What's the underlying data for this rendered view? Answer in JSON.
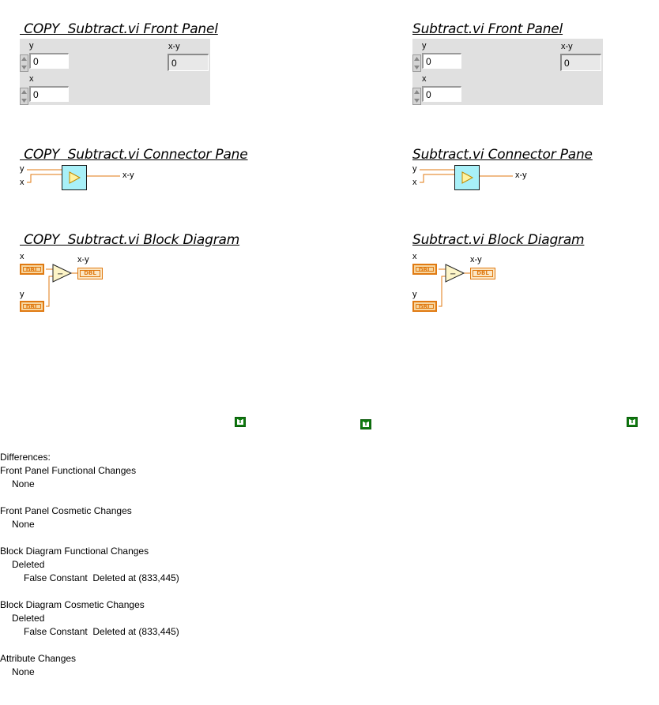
{
  "left": {
    "titles": {
      "front_panel": " COPY  Subtract.vi Front Panel",
      "connector_pane": " COPY  Subtract.vi Connector Pane",
      "block_diagram": " COPY  Subtract.vi Block Diagram"
    }
  },
  "right": {
    "titles": {
      "front_panel": "Subtract.vi Front Panel",
      "connector_pane": "Subtract.vi Connector Pane",
      "block_diagram": "Subtract.vi Block Diagram"
    }
  },
  "front_panel": {
    "y_label": "y",
    "y_value": "0",
    "x_label": "x",
    "x_value": "0",
    "xy_label": "x-y",
    "xy_value": "0"
  },
  "connector": {
    "y_label": "y",
    "x_label": "x",
    "out_label": "x-y"
  },
  "block_diagram": {
    "x_label": "x",
    "y_label": "y",
    "out_label": "x-y",
    "terminal_type": "DBL",
    "op_symbol": "−",
    "true_constant": "T"
  },
  "differences": {
    "heading": "Differences:",
    "fp_functional": {
      "title": "Front Panel Functional Changes",
      "value": "None"
    },
    "fp_cosmetic": {
      "title": "Front Panel Cosmetic Changes",
      "value": "None"
    },
    "bd_functional": {
      "title": "Block Diagram Functional Changes",
      "kind": "Deleted",
      "item": "False Constant  Deleted at (833,445)"
    },
    "bd_cosmetic": {
      "title": "Block Diagram Cosmetic Changes",
      "kind": "Deleted",
      "item": "False Constant  Deleted at (833,445)"
    },
    "attributes": {
      "title": "Attribute Changes",
      "value": "None"
    }
  },
  "colors": {
    "wire": "#e07a12",
    "connector_fill": "#a8f0f8",
    "diagram_terminal": "#f7d6a0",
    "true_constant": "#0f7a0f"
  }
}
